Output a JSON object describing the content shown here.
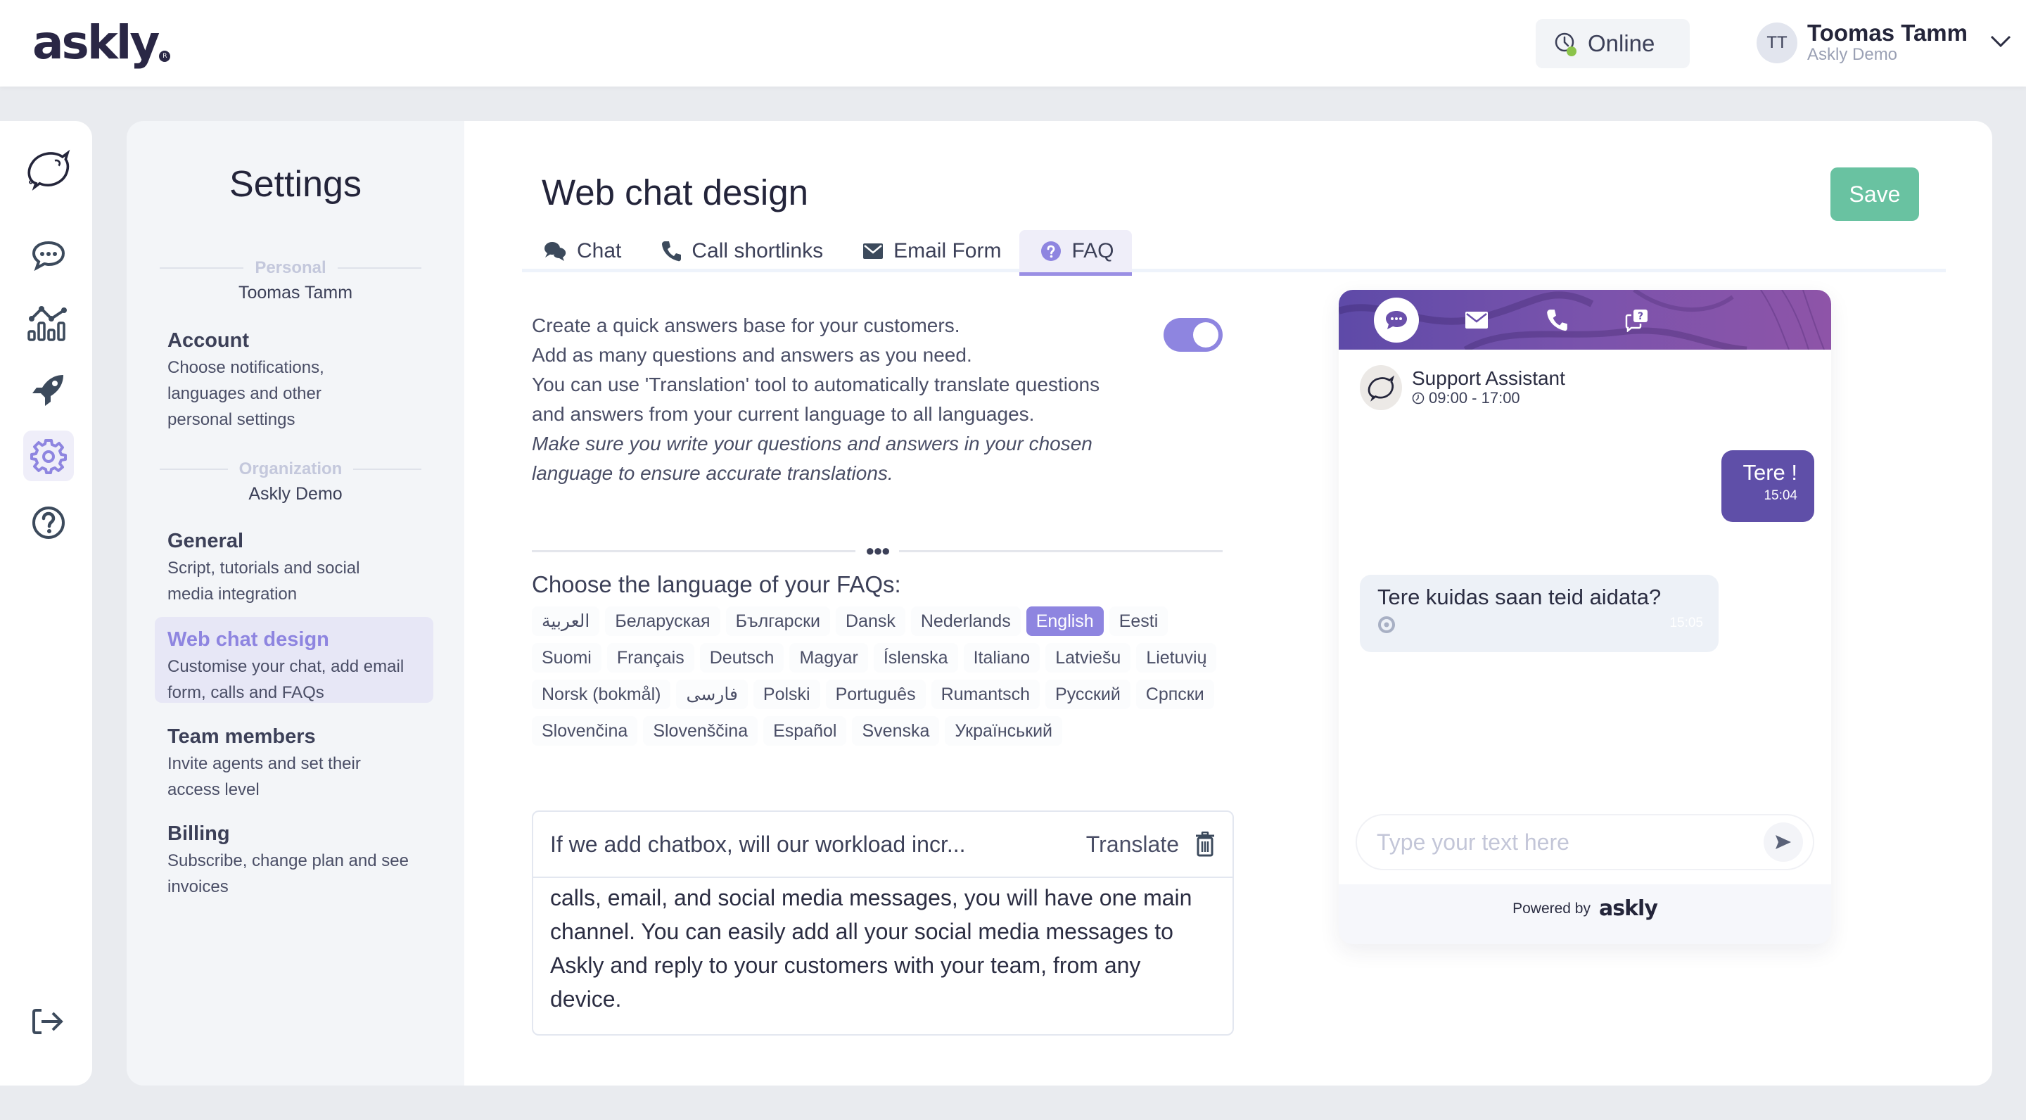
{
  "header": {
    "logo": "askly",
    "status_label": "Online",
    "status_color": "#8bc34a",
    "user": {
      "initials": "TT",
      "name": "Toomas Tamm",
      "org": "Askly Demo"
    }
  },
  "rail": {
    "items": [
      {
        "icon": "askly-bird-logo-icon"
      },
      {
        "icon": "chat-bubble-icon"
      },
      {
        "icon": "analytics-icon"
      },
      {
        "icon": "rocket-icon"
      },
      {
        "icon": "gear-icon",
        "active": true
      },
      {
        "icon": "help-icon"
      },
      {
        "icon": "logout-icon"
      }
    ]
  },
  "settings": {
    "title": "Settings",
    "personal": {
      "label": "Personal",
      "owner": "Toomas Tamm"
    },
    "organization": {
      "label": "Organization",
      "owner": "Askly Demo"
    },
    "items": [
      {
        "title": "Account",
        "desc": "Choose notifications, languages and other personal settings"
      },
      {
        "title": "General",
        "desc": "Script, tutorials and social media integration"
      },
      {
        "title": "Web chat design",
        "desc": "Customise your chat, add email form, calls and FAQs",
        "active": true
      },
      {
        "title": "Team members",
        "desc": "Invite agents and set their access level"
      },
      {
        "title": "Billing",
        "desc": "Subscribe, change plan and see invoices"
      }
    ]
  },
  "main": {
    "title": "Web chat design",
    "save_label": "Save",
    "tabs": [
      {
        "label": "Chat",
        "icon": "chat-icon"
      },
      {
        "label": "Call shortlinks",
        "icon": "phone-icon"
      },
      {
        "label": "Email Form",
        "icon": "envelope-icon"
      },
      {
        "label": "FAQ",
        "icon": "question-circle-icon",
        "active": true
      }
    ],
    "faq": {
      "enabled": true,
      "description": [
        "Create a quick answers base for your customers.",
        "Add as many questions and answers as you need.",
        "You can use 'Translation' tool to automatically translate questions and answers from your current language to all languages."
      ],
      "note": "Make sure you write your questions and answers in your chosen language to ensure accurate translations.",
      "language_heading": "Choose the language of your FAQs:",
      "languages": [
        "العربية",
        "Беларуская",
        "Български",
        "Dansk",
        "Nederlands",
        "English",
        "Eesti",
        "Suomi",
        "Français",
        "Deutsch",
        "Magyar",
        "Íslenska",
        "Italiano",
        "Latviešu",
        "Lietuvių",
        "Norsk (bokmål)",
        "فارسی",
        "Polski",
        "Português",
        "Rumantsch",
        "Русский",
        "Српски",
        "Slovenčina",
        "Slovenščina",
        "Español",
        "Svenska",
        "Український"
      ],
      "selected_language": "English",
      "item": {
        "question": "If we add chatbox, will our workload incr...",
        "translate_label": "Translate",
        "answer": "calls, email, and social media messages, you will have one main channel. You can easily add all your social media messages to Askly and reply to your customers with your team, from any device."
      }
    }
  },
  "widget": {
    "agent_name": "Support Assistant",
    "hours": "09:00 - 17:00",
    "messages": [
      {
        "direction": "out",
        "text": "Tere !",
        "time": "15:04"
      },
      {
        "direction": "in",
        "text": "Tere kuidas saan teid aidata?",
        "time": "15:05"
      }
    ],
    "input_placeholder": "Type your text here",
    "powered_by": "Powered by",
    "brand": "askly"
  },
  "colors": {
    "accent": "#8e85e0",
    "save": "#69c2a1",
    "widget_header": "#6a4fab",
    "outgoing_bubble": "#5f4fa8"
  }
}
